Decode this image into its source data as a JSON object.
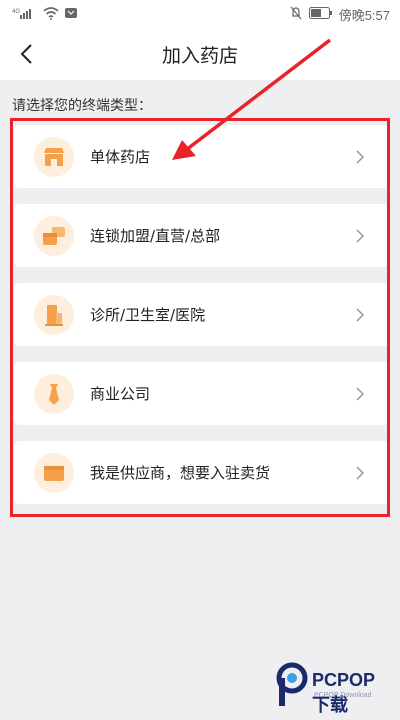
{
  "status_bar": {
    "signal_label": "4G",
    "clock": "傍晚5:57"
  },
  "header": {
    "title": "加入药店"
  },
  "main": {
    "prompt": "请选择您的终端类型：",
    "items": [
      {
        "label": "单体药店",
        "icon": "store-icon"
      },
      {
        "label": "连锁加盟/直营/总部",
        "icon": "chain-stores-icon"
      },
      {
        "label": "诊所/卫生室/医院",
        "icon": "clinic-building-icon"
      },
      {
        "label": "商业公司",
        "icon": "necktie-icon"
      },
      {
        "label": "我是供应商，想要入驻卖货",
        "icon": "box-icon"
      }
    ]
  },
  "watermark": {
    "brand": "PCPOP下载",
    "sub": "PCPOP Download"
  },
  "colors": {
    "accent_orange": "#f5a04a",
    "icon_bg": "#fdeedd",
    "highlight_red": "#e8232a"
  }
}
